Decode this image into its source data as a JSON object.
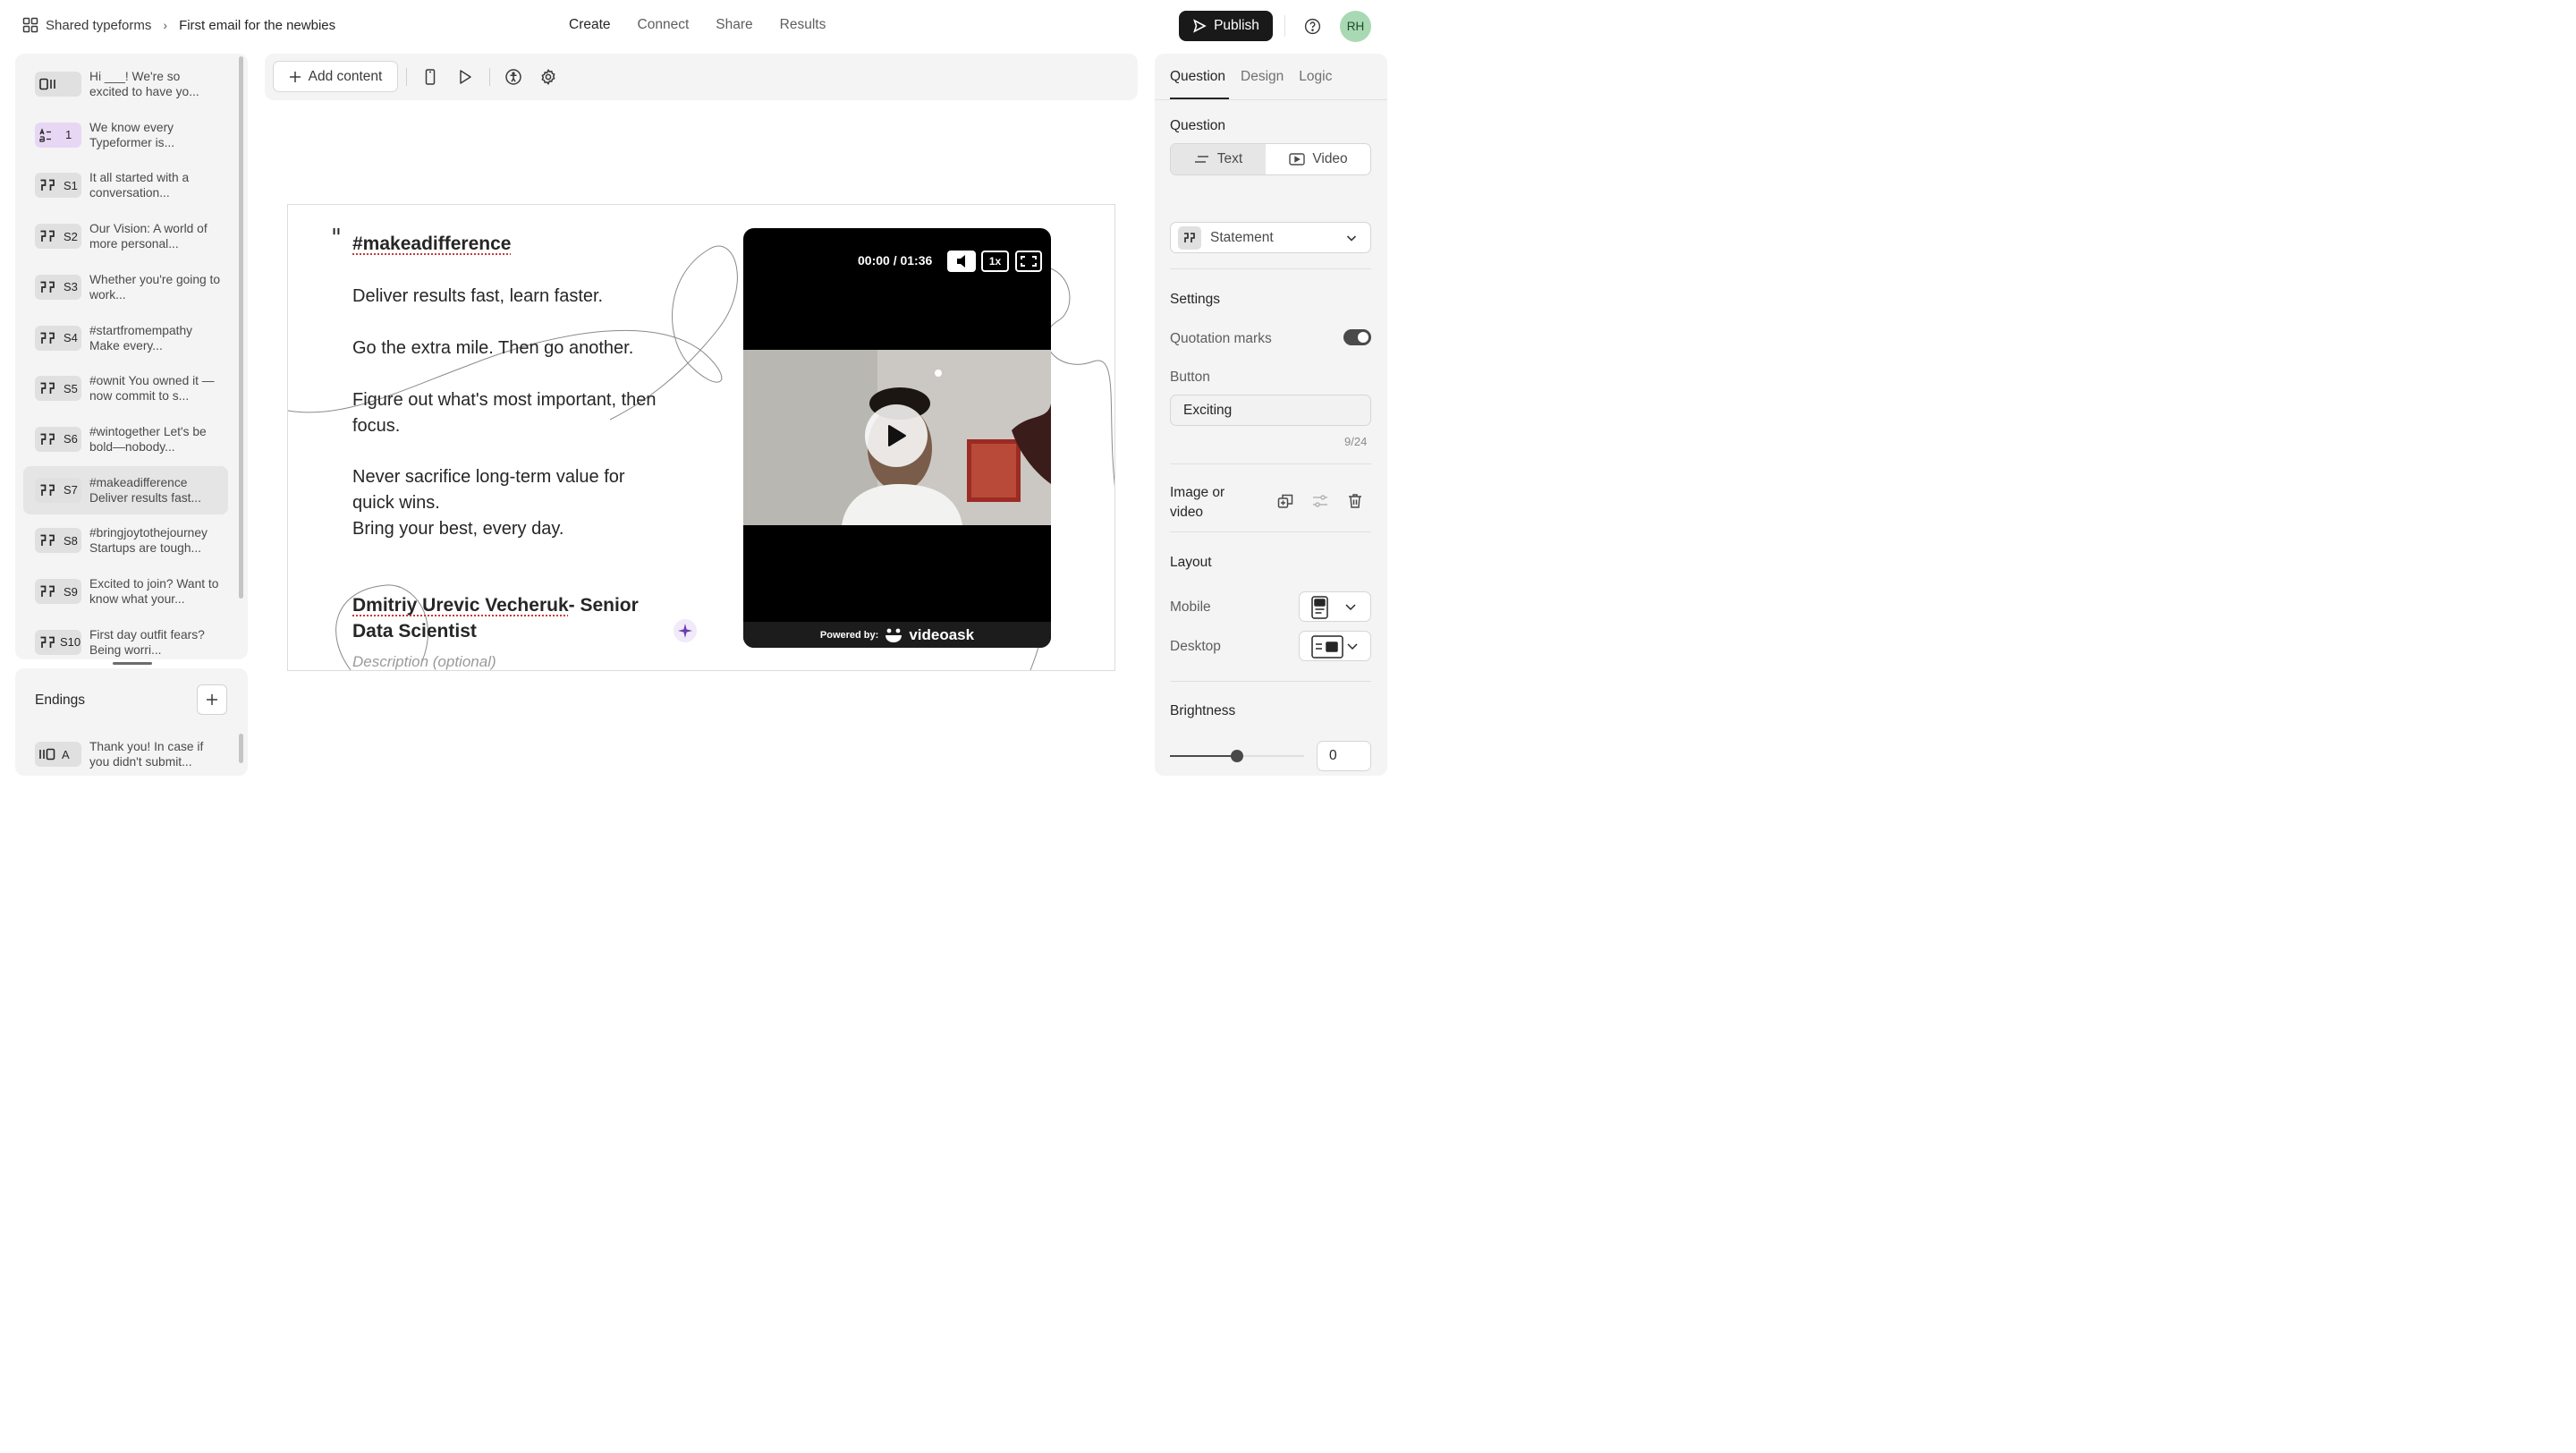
{
  "breadcrumb": {
    "workspace": "Shared typeforms",
    "form": "First email for the newbies"
  },
  "nav_tabs": [
    "Create",
    "Connect",
    "Share",
    "Results"
  ],
  "publish_label": "Publish",
  "avatar_initials": "RH",
  "questions": [
    {
      "tag": "",
      "icon": "welcome-screen-icon",
      "text": "Hi ___! We're so excited to have yo..."
    },
    {
      "tag": "1",
      "icon": "ranking-icon",
      "text": "We know every Typeformer is..."
    },
    {
      "tag": "S1",
      "icon": "quote-icon",
      "text": "It all started with a conversation..."
    },
    {
      "tag": "S2",
      "icon": "quote-icon",
      "text": "Our Vision: A world of more personal..."
    },
    {
      "tag": "S3",
      "icon": "quote-icon",
      "text": "Whether you're going to work..."
    },
    {
      "tag": "S4",
      "icon": "quote-icon",
      "text": "#startfromempathy Make every..."
    },
    {
      "tag": "S5",
      "icon": "quote-icon",
      "text": "#ownit You owned it —now commit to s..."
    },
    {
      "tag": "S6",
      "icon": "quote-icon",
      "text": "#wintogether Let's be bold—nobody..."
    },
    {
      "tag": "S7",
      "icon": "quote-icon",
      "text": "#makeadifference Deliver results fast..."
    },
    {
      "tag": "S8",
      "icon": "quote-icon",
      "text": "#bringjoytothejourney Startups are tough..."
    },
    {
      "tag": "S9",
      "icon": "quote-icon",
      "text": "Excited to join? Want to know what your..."
    },
    {
      "tag": "S10",
      "icon": "quote-icon",
      "text": "First day outfit fears? Being worri..."
    }
  ],
  "endings": {
    "title": "Endings",
    "items": [
      {
        "tag": "A",
        "icon": "ending-screen-icon",
        "text": "Thank you! In case if you didn't submit..."
      }
    ]
  },
  "toolbar": {
    "add_content": "Add content"
  },
  "statement": {
    "headline": "#makeadifference",
    "lines": [
      "Deliver results fast, learn faster.",
      "Go the extra mile. Then go another.",
      "Figure out what's most important, then focus.",
      "Never sacrifice long-term value for quick wins.\nBring your best, every day."
    ],
    "author_underlined": "Dmitriy Urevic Vecheruk",
    "author_rest": "- Senior Data Scientist",
    "description_placeholder": "Description (optional)"
  },
  "video": {
    "time": "00:00 / 01:36",
    "speed": "1x",
    "powered_by": "Powered by:",
    "brand": "videoask"
  },
  "right_panel": {
    "tabs": [
      "Question",
      "Design",
      "Logic"
    ],
    "question_label": "Question",
    "type_options": [
      "Text",
      "Video"
    ],
    "question_type": "Statement",
    "settings_label": "Settings",
    "quotation_marks_label": "Quotation marks",
    "quotation_marks_on": true,
    "button_label": "Button",
    "button_value": "Exciting",
    "button_counter": "9/24",
    "image_or_video_label": "Image or\nvideo",
    "layout_label": "Layout",
    "mobile_label": "Mobile",
    "desktop_label": "Desktop",
    "brightness_label": "Brightness",
    "brightness_value": "0",
    "brightness_slider_fraction": 0.5
  }
}
